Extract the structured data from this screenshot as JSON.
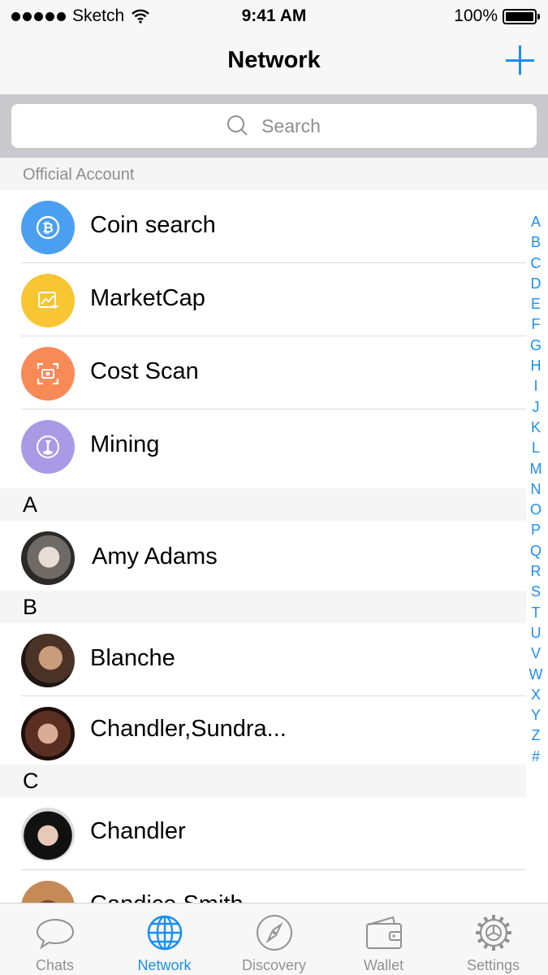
{
  "status_bar": {
    "carrier": "Sketch",
    "time": "9:41 AM",
    "battery": "100%"
  },
  "nav": {
    "title": "Network"
  },
  "search": {
    "placeholder": "Search"
  },
  "official": {
    "header": "Official Account",
    "items": [
      {
        "label": "Coin search",
        "icon": "bitcoin-search-icon",
        "color": "#4a9ff0"
      },
      {
        "label": "MarketCap",
        "icon": "chart-icon",
        "color": "#f8c533"
      },
      {
        "label": "Cost Scan",
        "icon": "scan-icon",
        "color": "#f88a58"
      },
      {
        "label": "Mining",
        "icon": "pickaxe-icon",
        "color": "#a99ae6"
      }
    ]
  },
  "sections": [
    {
      "letter": "A",
      "contacts": [
        "Amy Adams"
      ]
    },
    {
      "letter": "B",
      "contacts": [
        "Blanche",
        "Chandler,Sundra..."
      ]
    },
    {
      "letter": "C",
      "contacts": [
        "Chandler",
        "Candice Smith"
      ]
    }
  ],
  "index_letters": [
    "A",
    "B",
    "C",
    "D",
    "E",
    "F",
    "G",
    "H",
    "I",
    "J",
    "K",
    "L",
    "M",
    "N",
    "O",
    "P",
    "Q",
    "R",
    "S",
    "T",
    "U",
    "V",
    "W",
    "X",
    "Y",
    "Z",
    "#"
  ],
  "tabs": [
    {
      "label": "Chats",
      "icon": "chat-bubble-icon",
      "active": false
    },
    {
      "label": "Network",
      "icon": "globe-icon",
      "active": true
    },
    {
      "label": "Discovery",
      "icon": "compass-icon",
      "active": false
    },
    {
      "label": "Wallet",
      "icon": "wallet-icon",
      "active": false
    },
    {
      "label": "Settings",
      "icon": "gear-icon",
      "active": false
    }
  ]
}
